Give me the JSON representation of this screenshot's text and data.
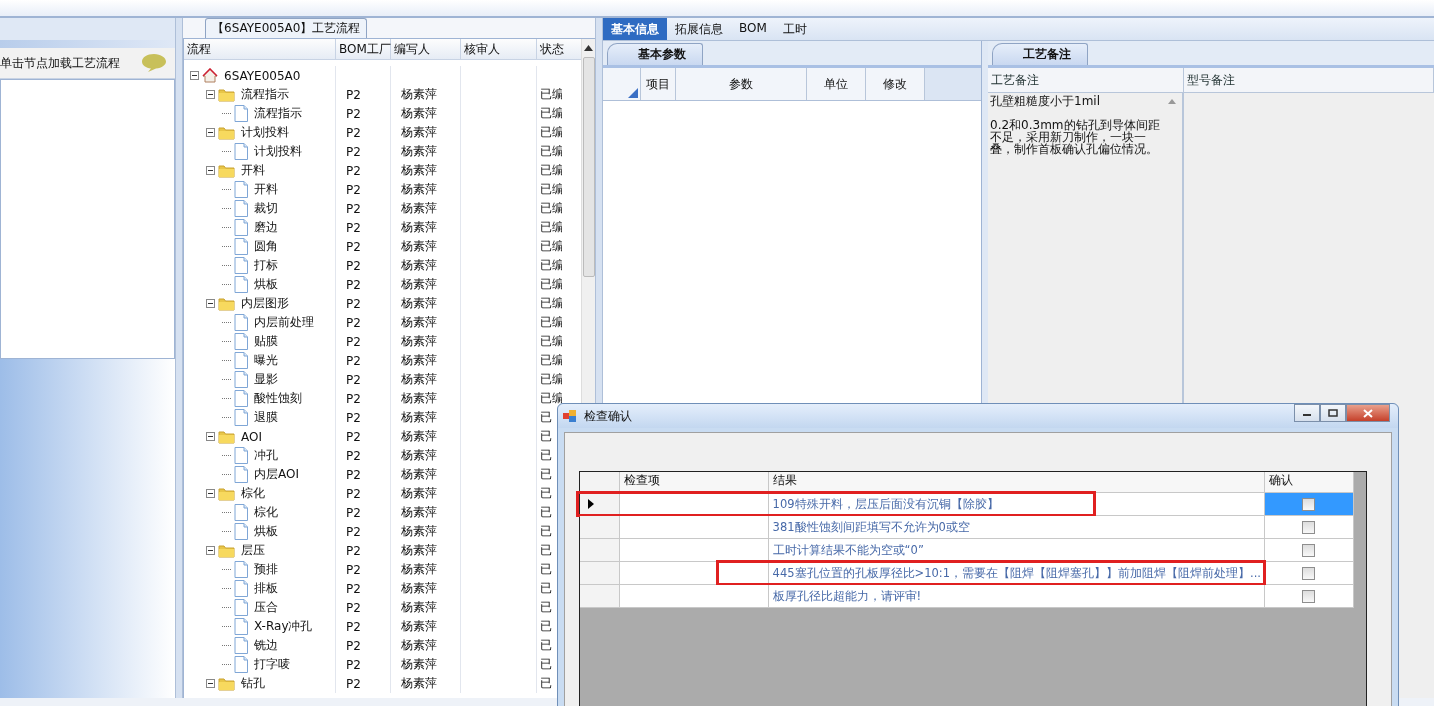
{
  "left_panel": {
    "item": "单击节点加载工艺流程"
  },
  "process_group": {
    "title": "【6SAYE005A0】工艺流程"
  },
  "tree_grid": {
    "columns": [
      "流程",
      "BOM工厂",
      "编写人",
      "核审人",
      "状态"
    ],
    "rows": [
      {
        "name": "6SAYE005A0",
        "kind": "root",
        "expanded": true,
        "children": [
          {
            "name": "流程指示",
            "kind": "folder",
            "expanded": true,
            "factory": "P2",
            "author": "杨素萍",
            "status": "已编",
            "children": [
              {
                "name": "流程指示",
                "kind": "step",
                "factory": "P2",
                "author": "杨素萍",
                "status": "已编"
              }
            ]
          },
          {
            "name": "计划投料",
            "kind": "folder",
            "expanded": true,
            "factory": "P2",
            "author": "杨素萍",
            "status": "已编",
            "children": [
              {
                "name": "计划投料",
                "kind": "step",
                "factory": "P2",
                "author": "杨素萍",
                "status": "已编"
              }
            ]
          },
          {
            "name": "开料",
            "kind": "folder",
            "expanded": true,
            "factory": "P2",
            "author": "杨素萍",
            "status": "已编",
            "children": [
              {
                "name": "开料",
                "kind": "step",
                "factory": "P2",
                "author": "杨素萍",
                "status": "已编"
              },
              {
                "name": "裁切",
                "kind": "step",
                "factory": "P2",
                "author": "杨素萍",
                "status": "已编"
              },
              {
                "name": "磨边",
                "kind": "step",
                "factory": "P2",
                "author": "杨素萍",
                "status": "已编"
              },
              {
                "name": "圆角",
                "kind": "step",
                "factory": "P2",
                "author": "杨素萍",
                "status": "已编"
              },
              {
                "name": "打标",
                "kind": "step",
                "factory": "P2",
                "author": "杨素萍",
                "status": "已编"
              },
              {
                "name": "烘板",
                "kind": "step",
                "factory": "P2",
                "author": "杨素萍",
                "status": "已编"
              }
            ]
          },
          {
            "name": "内层图形",
            "kind": "folder",
            "expanded": true,
            "factory": "P2",
            "author": "杨素萍",
            "status": "已编",
            "children": [
              {
                "name": "内层前处理",
                "kind": "step",
                "factory": "P2",
                "author": "杨素萍",
                "status": "已编"
              },
              {
                "name": "贴膜",
                "kind": "step",
                "factory": "P2",
                "author": "杨素萍",
                "status": "已编"
              },
              {
                "name": "曝光",
                "kind": "step",
                "factory": "P2",
                "author": "杨素萍",
                "status": "已编"
              },
              {
                "name": "显影",
                "kind": "step",
                "factory": "P2",
                "author": "杨素萍",
                "status": "已编"
              },
              {
                "name": "酸性蚀刻",
                "kind": "step",
                "factory": "P2",
                "author": "杨素萍",
                "status": "已编"
              },
              {
                "name": "退膜",
                "kind": "step",
                "factory": "P2",
                "author": "杨素萍",
                "status": "已"
              }
            ]
          },
          {
            "name": "AOI",
            "kind": "folder",
            "expanded": true,
            "factory": "P2",
            "author": "杨素萍",
            "status": "已",
            "children": [
              {
                "name": "冲孔",
                "kind": "step",
                "factory": "P2",
                "author": "杨素萍",
                "status": "已"
              },
              {
                "name": "内层AOI",
                "kind": "step",
                "factory": "P2",
                "author": "杨素萍",
                "status": "已"
              }
            ]
          },
          {
            "name": "棕化",
            "kind": "folder",
            "expanded": true,
            "factory": "P2",
            "author": "杨素萍",
            "status": "已",
            "children": [
              {
                "name": "棕化",
                "kind": "step",
                "factory": "P2",
                "author": "杨素萍",
                "status": "已"
              },
              {
                "name": "烘板",
                "kind": "step",
                "factory": "P2",
                "author": "杨素萍",
                "status": "已"
              }
            ]
          },
          {
            "name": "层压",
            "kind": "folder",
            "expanded": true,
            "factory": "P2",
            "author": "杨素萍",
            "status": "已",
            "children": [
              {
                "name": "预排",
                "kind": "step",
                "factory": "P2",
                "author": "杨素萍",
                "status": "已"
              },
              {
                "name": "排板",
                "kind": "step",
                "factory": "P2",
                "author": "杨素萍",
                "status": "已"
              },
              {
                "name": "压合",
                "kind": "step",
                "factory": "P2",
                "author": "杨素萍",
                "status": "已"
              },
              {
                "name": "X-Ray冲孔",
                "kind": "step",
                "factory": "P2",
                "author": "杨素萍",
                "status": "已"
              },
              {
                "name": "铣边",
                "kind": "step",
                "factory": "P2",
                "author": "杨素萍",
                "status": "已"
              },
              {
                "name": "打字唛",
                "kind": "step",
                "factory": "P2",
                "author": "杨素萍",
                "status": "已"
              }
            ]
          },
          {
            "name": "钻孔",
            "kind": "folder",
            "expanded": true,
            "factory": "P2",
            "author": "杨素萍",
            "status": "已"
          }
        ]
      }
    ]
  },
  "tabs": [
    {
      "label": "基本信息",
      "selected": true
    },
    {
      "label": "拓展信息",
      "selected": false
    },
    {
      "label": "BOM",
      "selected": false
    },
    {
      "label": "工时",
      "selected": false
    }
  ],
  "params_panel": {
    "tab": "基本参数",
    "columns": [
      "项目",
      "参数",
      "单位",
      "修改"
    ]
  },
  "notes_panel": {
    "tab": "工艺备注",
    "columns": [
      "工艺备注",
      "型号备注"
    ],
    "notes": [
      "孔壁粗糙度小于1mil",
      "0.2和0.3mm的钻孔到导体间距不足，采用新刀制作，一块一叠，制作首板确认孔偏位情况。"
    ]
  },
  "dialog": {
    "title": "检查确认",
    "columns": [
      "检查项",
      "结果",
      "确认"
    ],
    "rows": [
      {
        "result": "109特殊开料，层压后面没有沉铜【除胶】",
        "checked": false,
        "selected": true,
        "flagged": true
      },
      {
        "result": "381酸性蚀刻间距填写不允许为0或空",
        "checked": false,
        "selected": false,
        "flagged": false
      },
      {
        "result": "工时计算结果不能为空或“0”",
        "checked": false,
        "selected": false,
        "flagged": false
      },
      {
        "result": "445塞孔位置的孔板厚径比>10:1，需要在【阻焊【阻焊塞孔】】前加阻焊【阻焊前处理】...",
        "checked": false,
        "selected": false,
        "flagged": true
      },
      {
        "result": "板厚孔径比超能力，请评审!",
        "checked": false,
        "selected": false,
        "flagged": false
      }
    ]
  }
}
